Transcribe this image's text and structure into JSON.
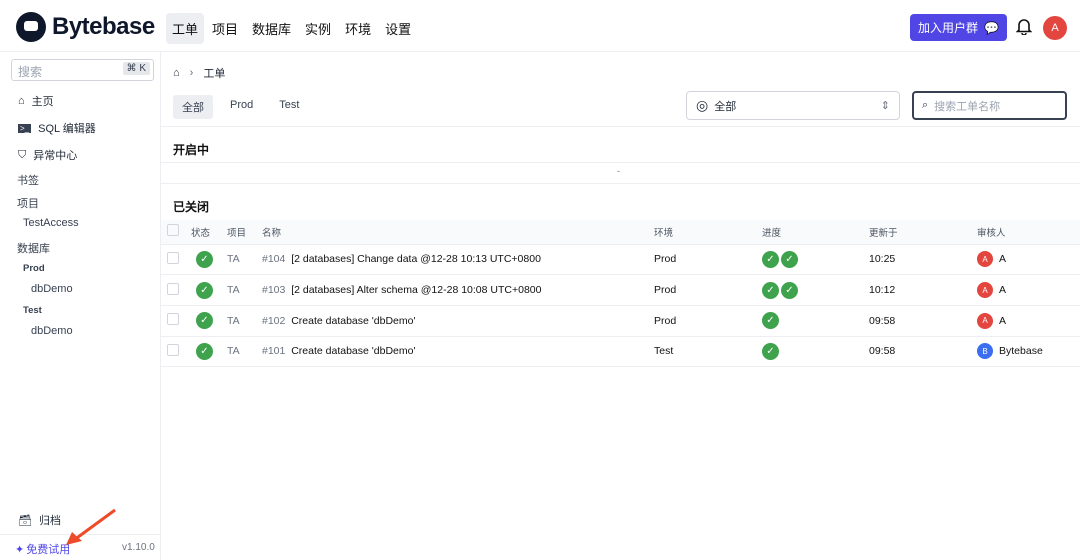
{
  "header": {
    "brand": "Bytebase",
    "nav": [
      "工单",
      "项目",
      "数据库",
      "实例",
      "环境",
      "设置"
    ],
    "join_label": "加入用户群",
    "user_initial": "A"
  },
  "sidebar": {
    "search_placeholder": "搜索",
    "shortcut": "⌘ K",
    "home": "主页",
    "sql_editor": "SQL 编辑器",
    "anomaly": "异常中心",
    "bookmarks": "书签",
    "projects": "项目",
    "project_items": [
      "TestAccess"
    ],
    "databases": "数据库",
    "env_groups": [
      {
        "env": "Prod",
        "db": "dbDemo"
      },
      {
        "env": "Test",
        "db": "dbDemo"
      }
    ],
    "archive": "归档",
    "free_trial": "免费试用",
    "version": "v1.10.0"
  },
  "main": {
    "breadcrumb": "工单",
    "tabs": [
      "全部",
      "Prod",
      "Test"
    ],
    "assignee_select": "全部",
    "search_placeholder": "搜索工单名称",
    "open_section": "开启中",
    "open_empty": "-",
    "closed_section": "已关闭",
    "columns": [
      "状态",
      "项目",
      "名称",
      "环境",
      "进度",
      "更新于",
      "审核人"
    ],
    "rows": [
      {
        "project": "TA",
        "id": "#104",
        "title": "[2 databases] Change data @12-28 10:13 UTC+0800",
        "env": "Prod",
        "steps": 2,
        "updated": "10:25",
        "reviewer": "A",
        "reviewer_initial": "A",
        "reviewer_color": "#e2463e"
      },
      {
        "project": "TA",
        "id": "#103",
        "title": "[2 databases] Alter schema @12-28 10:08 UTC+0800",
        "env": "Prod",
        "steps": 2,
        "updated": "10:12",
        "reviewer": "A",
        "reviewer_initial": "A",
        "reviewer_color": "#e2463e"
      },
      {
        "project": "TA",
        "id": "#102",
        "title": "Create database 'dbDemo'",
        "env": "Prod",
        "steps": 1,
        "updated": "09:58",
        "reviewer": "A",
        "reviewer_initial": "A",
        "reviewer_color": "#e2463e"
      },
      {
        "project": "TA",
        "id": "#101",
        "title": "Create database 'dbDemo'",
        "env": "Test",
        "steps": 1,
        "updated": "09:58",
        "reviewer": "Bytebase",
        "reviewer_initial": "B",
        "reviewer_color": "#3b6ef0"
      }
    ]
  }
}
